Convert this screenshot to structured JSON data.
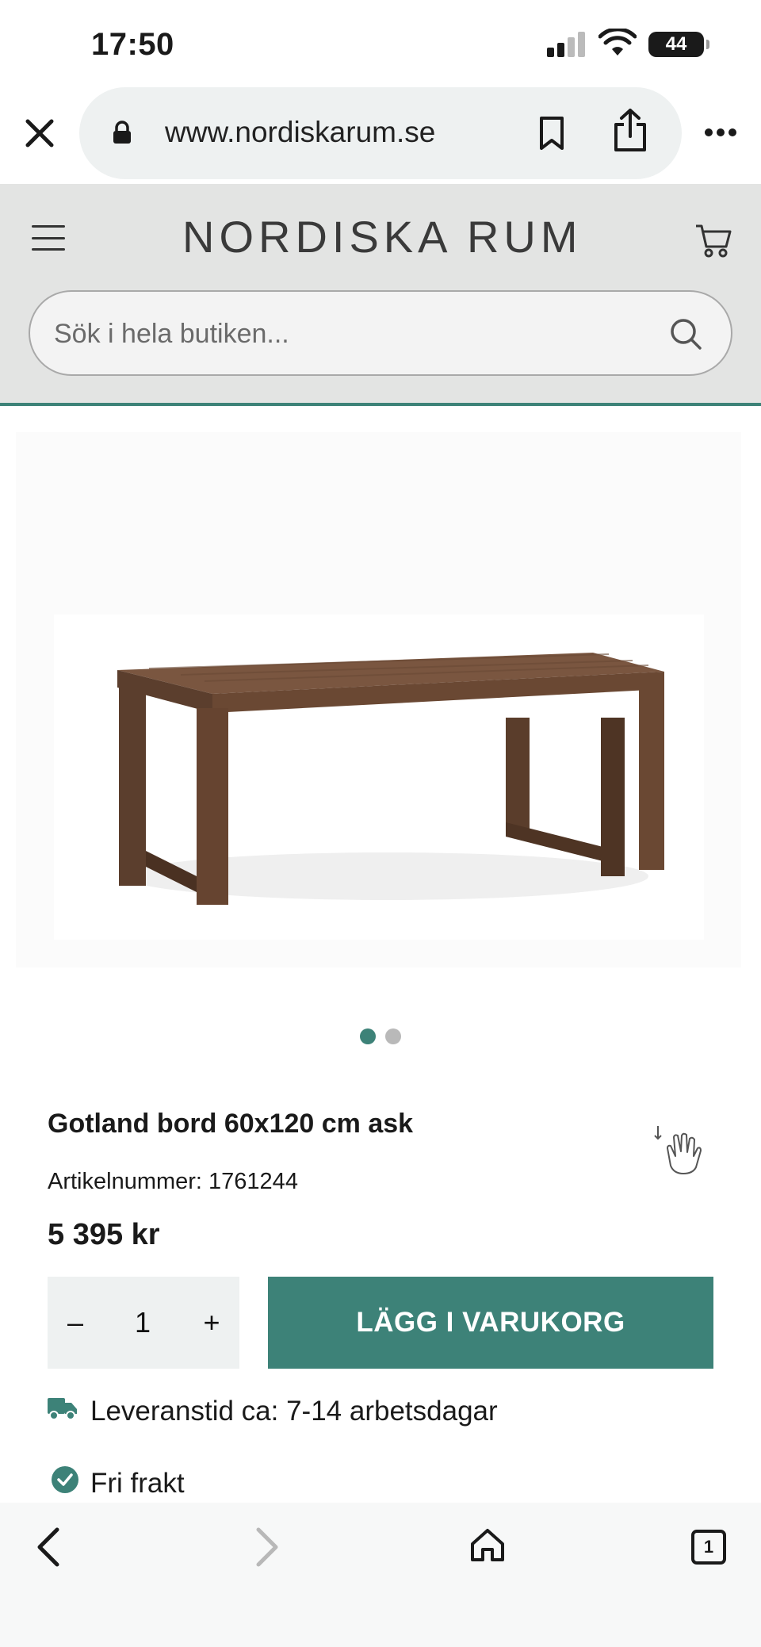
{
  "status_bar": {
    "time": "17:50",
    "battery": "44"
  },
  "browser": {
    "url": "www.nordiskarum.se",
    "icons": [
      "close-icon",
      "lock-icon",
      "bookmark-icon",
      "share-icon",
      "more-icon"
    ]
  },
  "header": {
    "logo": "NORDISKA RUM",
    "search_placeholder": "Sök i hela butiken...",
    "icons": [
      "menu-icon",
      "cart-icon",
      "search-icon"
    ],
    "accent_color": "#3d8278"
  },
  "product": {
    "title": "Gotland bord 60x120 cm ask",
    "article_number": "Artikelnummer: 1761244",
    "price": "5 395 kr",
    "quantity": "1",
    "qty_minus": "–",
    "qty_plus": "+",
    "add_to_cart_label": "LÄGG I VARUKORG",
    "delivery_text": "Leveranstid ca: 7-14 arbetsdagar",
    "free_shipping_text": "Fri frakt",
    "carousel": {
      "total": 2,
      "active": 1
    }
  },
  "toolbar": {
    "tabs_count": "1",
    "icons": [
      "back-icon",
      "forward-icon",
      "home-icon",
      "tabs-icon"
    ]
  }
}
